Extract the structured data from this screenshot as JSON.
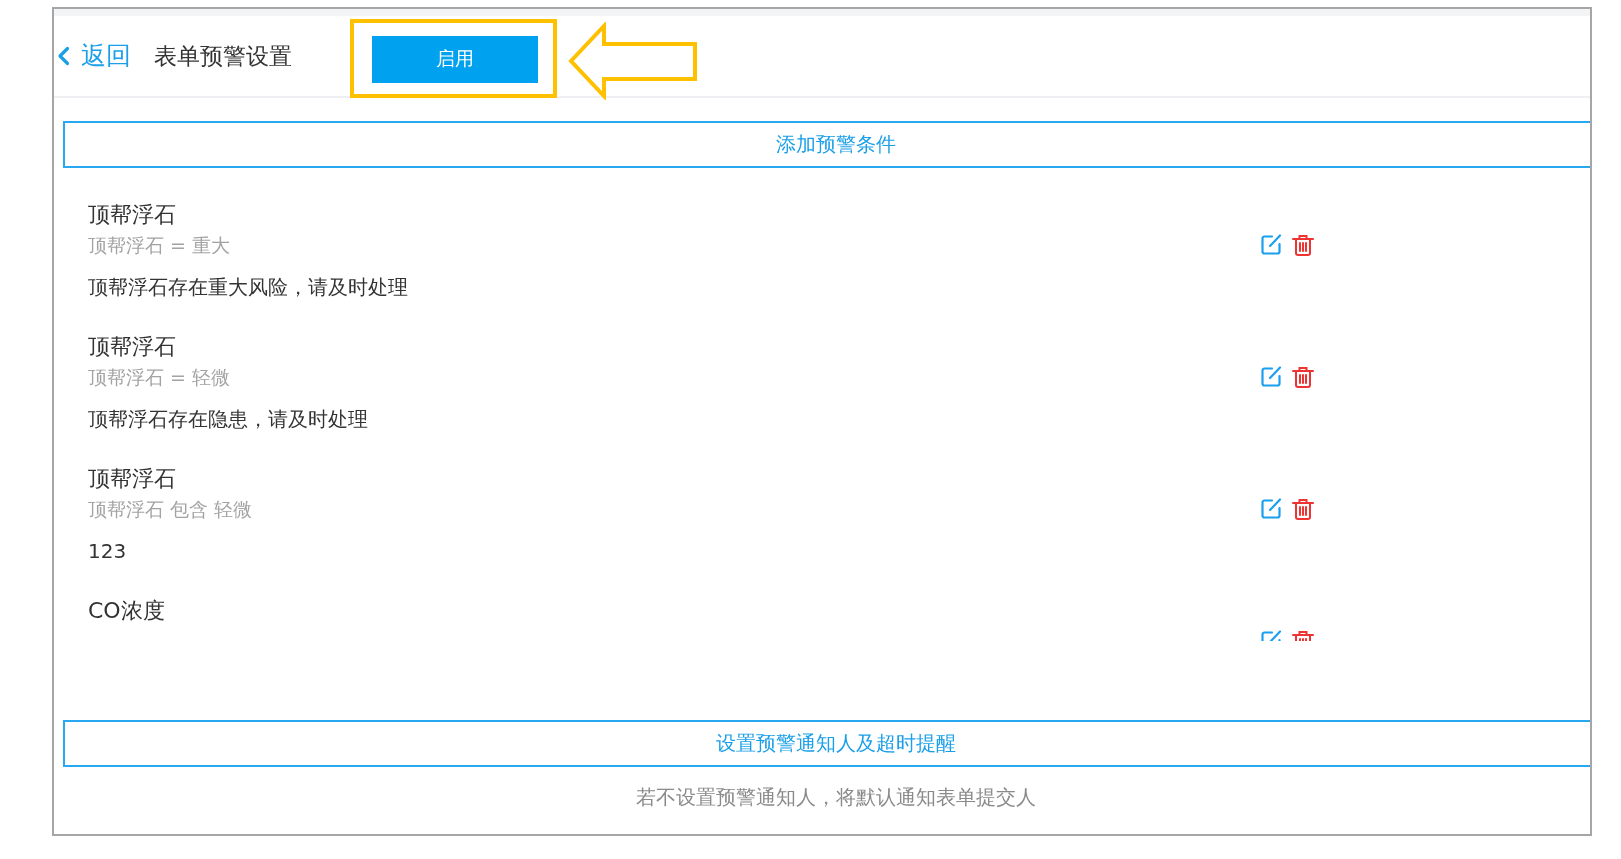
{
  "header": {
    "back_label": "返回",
    "title": "表单预警设置",
    "enable_button": {
      "label": "启用",
      "highlighted": true
    }
  },
  "add_condition_button": "添加预警条件",
  "conditions": [
    {
      "title": "顶帮浮石",
      "rule": "顶帮浮石 = 重大",
      "message": "顶帮浮石存在重大风险，请及时处理"
    },
    {
      "title": "顶帮浮石",
      "rule": "顶帮浮石 = 轻微",
      "message": "顶帮浮石存在隐患，请及时处理"
    },
    {
      "title": "顶帮浮石",
      "rule": "顶帮浮石 包含 轻微",
      "message": "123"
    },
    {
      "title": "CO浓度"
    }
  ],
  "notify_button": "设置预警通知人及超时提醒",
  "note": "若不设置预警通知人，将默认通知表单提交人"
}
